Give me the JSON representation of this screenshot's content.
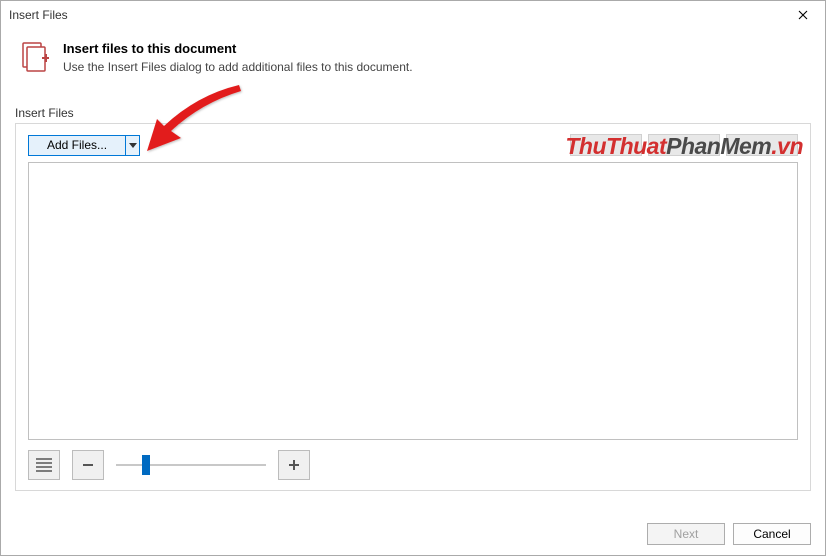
{
  "window": {
    "title": "Insert Files"
  },
  "header": {
    "heading": "Insert files to this document",
    "subtext": "Use the Insert Files dialog to add additional files to this document."
  },
  "section": {
    "label": "Insert Files",
    "add_files_label": "Add Files..."
  },
  "slider": {
    "min": 0,
    "max": 100,
    "value": 18
  },
  "footer": {
    "next_label": "Next",
    "cancel_label": "Cancel",
    "next_enabled": false
  },
  "watermark": {
    "part1": "ThuThuat",
    "part2": "PhanMem",
    "part3": ".vn"
  }
}
